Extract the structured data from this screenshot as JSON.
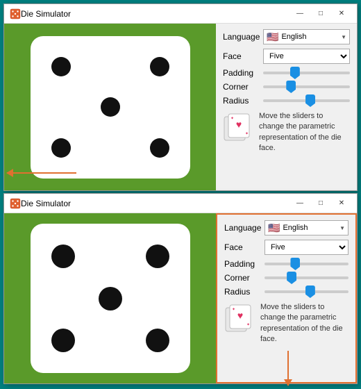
{
  "window1": {
    "title": "Die Simulator",
    "titlebar_controls": {
      "minimize": "—",
      "maximize": "□",
      "close": "✕"
    },
    "language_label": "Language",
    "language_value": "English",
    "face_label": "Face",
    "face_value": "Five",
    "padding_label": "Padding",
    "corner_label": "Corner",
    "radius_label": "Radius",
    "info_text": "Move the sliders to change the parametric representation of the die face.",
    "sliders": {
      "padding": 35,
      "corner": 30,
      "radius": 55
    }
  },
  "window2": {
    "title": "Die Simulator",
    "titlebar_controls": {
      "minimize": "—",
      "maximize": "□",
      "close": "✕"
    },
    "language_label": "Language",
    "language_value": "English",
    "face_label": "Face",
    "face_value": "Five",
    "padding_label": "Padding",
    "corner_label": "Corner",
    "radius_label": "Radius",
    "info_text": "Move the sliders to change the parametric representation of the die face.",
    "sliders": {
      "padding": 35,
      "corner": 30,
      "radius": 55
    }
  }
}
